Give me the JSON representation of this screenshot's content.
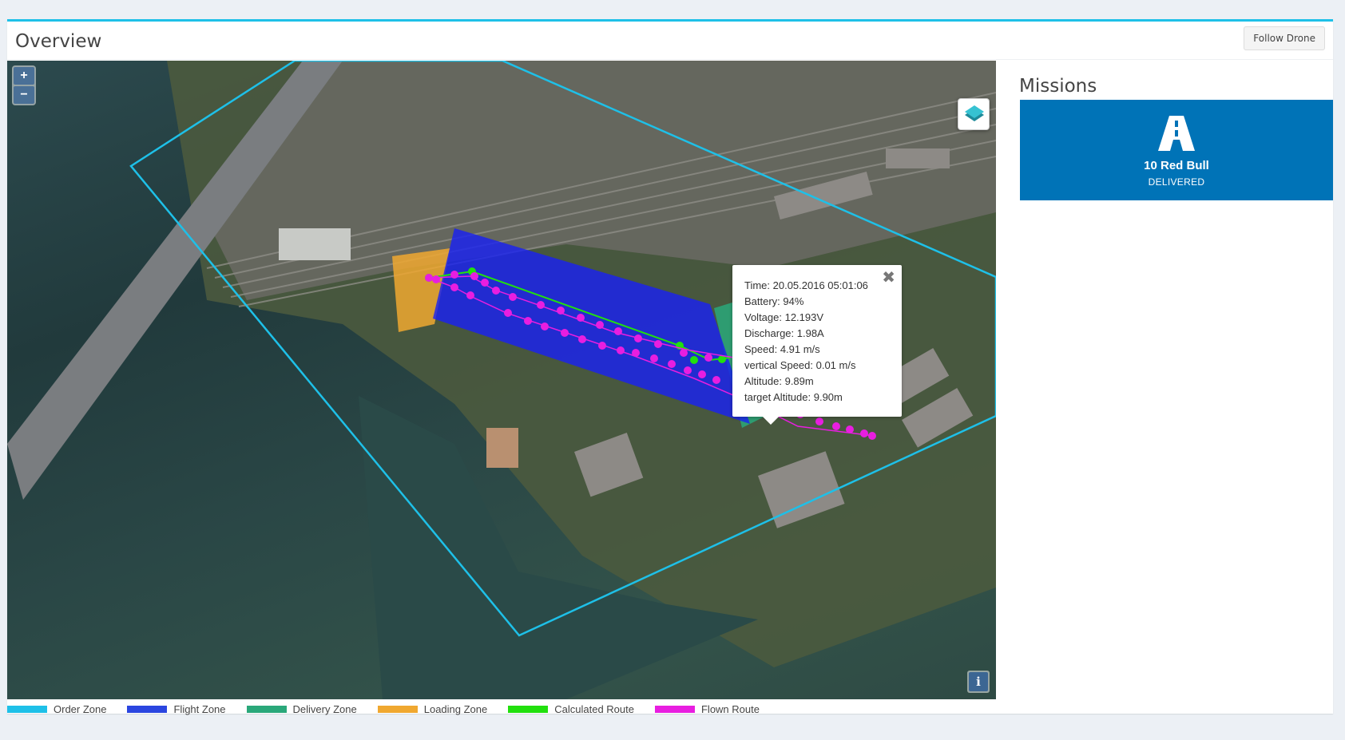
{
  "header": {
    "title": "Overview",
    "follow_button": "Follow Drone"
  },
  "map": {
    "zoom_in": "+",
    "zoom_out": "−",
    "info_button": "i",
    "layer_switcher": "layers-icon"
  },
  "popup": {
    "close": "✖",
    "rows": [
      "Time: 20.05.2016 05:01:06",
      "Battery: 94%",
      "Voltage: 12.193V",
      "Discharge: 1.98A",
      "Speed: 4.91 m/s",
      "vertical Speed: 0.01 m/s",
      "Altitude: 9.89m",
      "target Altitude: 9.90m"
    ]
  },
  "missions": {
    "title": "Missions",
    "card": {
      "name": "10 Red Bull",
      "status": "DELIVERED",
      "icon": "road-icon",
      "color": "#0073b7"
    }
  },
  "legend": [
    {
      "label": "Order Zone",
      "color": "#1ec0e8"
    },
    {
      "label": "Flight Zone",
      "color": "#2b46e0"
    },
    {
      "label": "Delivery Zone",
      "color": "#2aa87a"
    },
    {
      "label": "Loading Zone",
      "color": "#f0a830"
    },
    {
      "label": "Calculated Route",
      "color": "#22e00e"
    },
    {
      "label": "Flown Route",
      "color": "#e81ee0"
    }
  ]
}
